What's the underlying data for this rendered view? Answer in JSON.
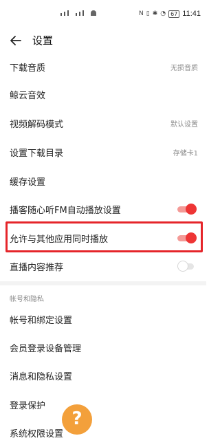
{
  "status_bar": {
    "time": "11:41",
    "battery": "67"
  },
  "header": {
    "title": "设置"
  },
  "settings": [
    {
      "label": "下载音质",
      "value": "无损音质"
    },
    {
      "label": "鲸云音效"
    },
    {
      "label": "视频解码模式",
      "value": "默认设置"
    },
    {
      "label": "设置下载目录",
      "value": "存储卡1"
    },
    {
      "label": "缓存设置"
    },
    {
      "label": "播客随心听FM自动播放设置",
      "toggle": "on"
    },
    {
      "label": "允许与其他应用同时播放",
      "toggle": "on"
    },
    {
      "label": "直播内容推荐",
      "toggle": "off"
    }
  ],
  "privacy_section": {
    "label": "帐号和隐私",
    "items": [
      {
        "label": "帐号和绑定设置"
      },
      {
        "label": "会员登录设备管理"
      },
      {
        "label": "消息和隐私设置"
      },
      {
        "label": "登录保护"
      },
      {
        "label": "系统权限设置"
      }
    ]
  },
  "help_badge": "?",
  "colors": {
    "toggle_on": "#ee3535",
    "highlight_border": "#e5252a",
    "help_badge": "#f3a03b"
  }
}
